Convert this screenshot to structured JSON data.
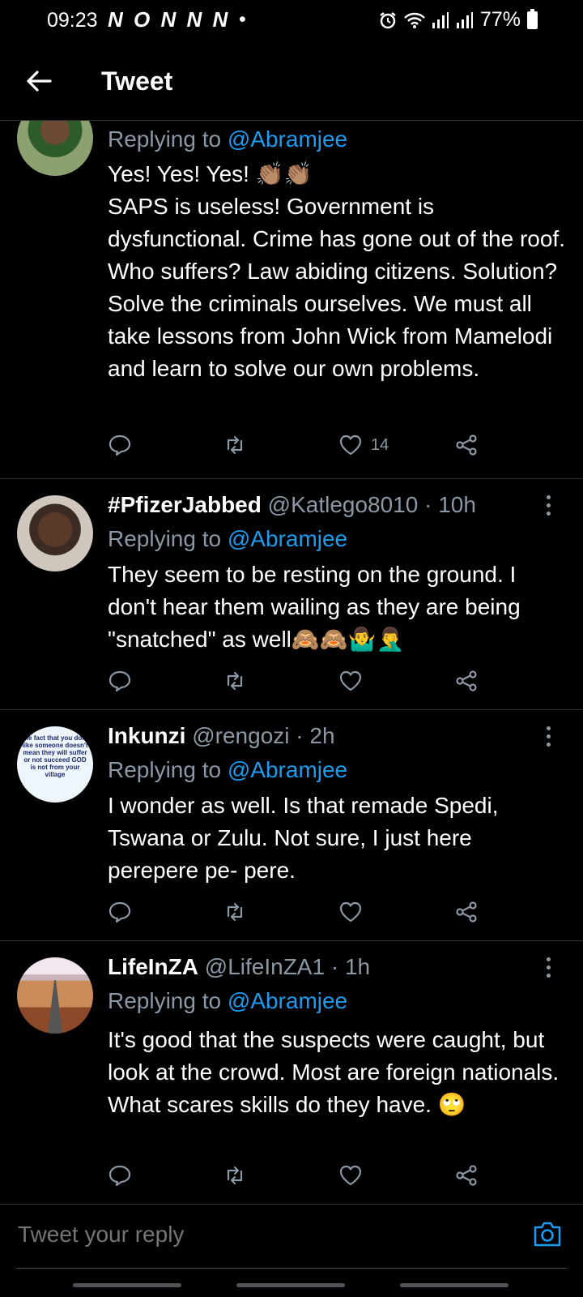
{
  "status_bar": {
    "time": "09:23",
    "carrier_icons": "N O N N N",
    "dot": "•",
    "battery": "77%"
  },
  "app_bar": {
    "title": "Tweet",
    "back_icon": "arrow-left-icon"
  },
  "tweets": [
    {
      "reply_prefix": "Replying to ",
      "reply_to": "@Abramjee",
      "text": [
        "Yes! Yes! Yes! 👏🏽👏🏽",
        "SAPS is useless! Government is dysfunctional. Crime has gone out of the roof. Who suffers? Law abiding citizens. Solution? Solve the criminals ourselves. We must all take lessons from John Wick from Mamelodi and learn to solve our own problems."
      ],
      "likes": "14"
    },
    {
      "name": "#PfizerJabbed",
      "handle": "@Katlego8010",
      "time": "· 10h",
      "reply_prefix": "Replying to ",
      "reply_to": "@Abramjee",
      "text": "They seem to be resting on the ground. I don't hear them wailing as they are being \"snatched\" as well🙈🙈🤷‍♂️🤦‍♂️",
      "likes": ""
    },
    {
      "name": "Inkunzi",
      "handle": "@rengozi",
      "time": "· 2h",
      "avatar_text": "The fact that you don't like someone doesn't mean they will suffer or not succeed GOD is not from your village",
      "reply_prefix": "Replying to ",
      "reply_to": "@Abramjee",
      "text": "I wonder as well. Is that remade Spedi, Tswana or Zulu. Not sure,  I just here perepere pe- pere.",
      "likes": ""
    },
    {
      "name": "LifeInZA",
      "handle": "@LifeInZA1",
      "time": "· 1h",
      "reply_prefix": "Replying to ",
      "reply_to": "@Abramjee",
      "text": "It's good that the suspects were caught, but look at the crowd. Most are foreign nationals. What scares skills do they have. 🙄",
      "likes": ""
    }
  ],
  "composer": {
    "placeholder": "Tweet your reply",
    "camera_icon": "camera-icon"
  },
  "colors": {
    "background": "#000000",
    "accent": "#1d9bf0",
    "muted": "#8b98a5",
    "divider": "#2f3336"
  }
}
